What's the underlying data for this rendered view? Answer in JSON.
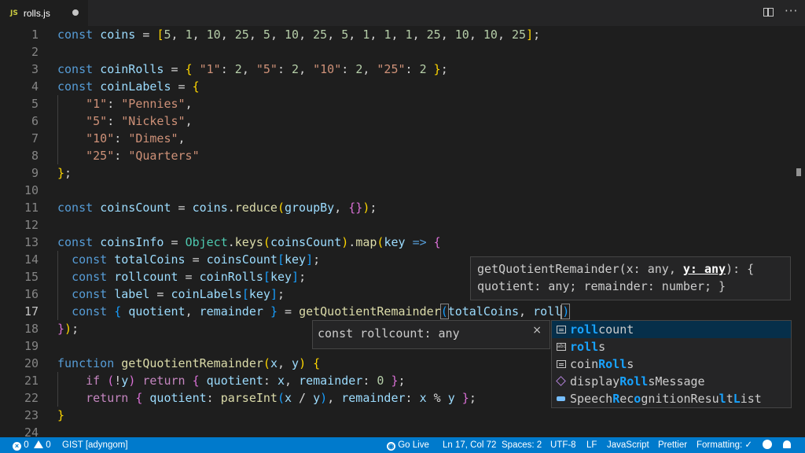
{
  "tab": {
    "lang_badge": "JS",
    "filename": "rolls.js"
  },
  "lines": [
    {
      "n": "1"
    },
    {
      "n": "2"
    },
    {
      "n": "3"
    },
    {
      "n": "4"
    },
    {
      "n": "5"
    },
    {
      "n": "6"
    },
    {
      "n": "7"
    },
    {
      "n": "8"
    },
    {
      "n": "9"
    },
    {
      "n": "10"
    },
    {
      "n": "11"
    },
    {
      "n": "12"
    },
    {
      "n": "13"
    },
    {
      "n": "14"
    },
    {
      "n": "15"
    },
    {
      "n": "16"
    },
    {
      "n": "17"
    },
    {
      "n": "18"
    },
    {
      "n": "19"
    },
    {
      "n": "20"
    },
    {
      "n": "21"
    },
    {
      "n": "22"
    },
    {
      "n": "23"
    },
    {
      "n": "24"
    }
  ],
  "signature_help": {
    "prefix": "getQuotientRemainder(x: any, ",
    "active_param": "y: any",
    "suffix": "): {",
    "line2": "quotient: any; remainder: number; }"
  },
  "hover": {
    "text": "const rollcount: any",
    "close": "×"
  },
  "suggestions": [
    {
      "match": "roll",
      "rest": "count",
      "kind": "variable",
      "selected": true
    },
    {
      "match": "roll",
      "rest": "s",
      "kind": "text",
      "selected": false
    },
    {
      "pre": "coin",
      "match": "Roll",
      "rest": "s",
      "kind": "variable",
      "selected": false
    },
    {
      "pre": "display",
      "match": "Roll",
      "rest": "sMessage",
      "kind": "module",
      "selected": false
    },
    {
      "pre": "Speech",
      "m1": "R",
      "mid1": "ec",
      "m2": "o",
      "mid2": "gnitionResu",
      "m3": "l",
      "mid3": "t",
      "m4": "L",
      "rest": "ist",
      "kind": "class",
      "selected": false
    }
  ],
  "statusbar": {
    "errors": "0",
    "warnings": "0",
    "gist": "GIST [adyngom]",
    "go_live": "Go Live",
    "position": "Ln 17, Col 72",
    "spaces": "Spaces: 2",
    "encoding": "UTF-8",
    "eol": "LF",
    "language": "JavaScript",
    "prettier": "Prettier",
    "formatting": "Formatting: ✓"
  },
  "colors": {
    "editor_bg": "#1e1e1e",
    "statusbar_bg": "#007acc",
    "keyword": "#569cd6",
    "variable": "#9cdcfe",
    "number": "#b5cea8",
    "string": "#ce9178",
    "function": "#dcdcaa",
    "suggest_highlight": "#18a3ff"
  }
}
